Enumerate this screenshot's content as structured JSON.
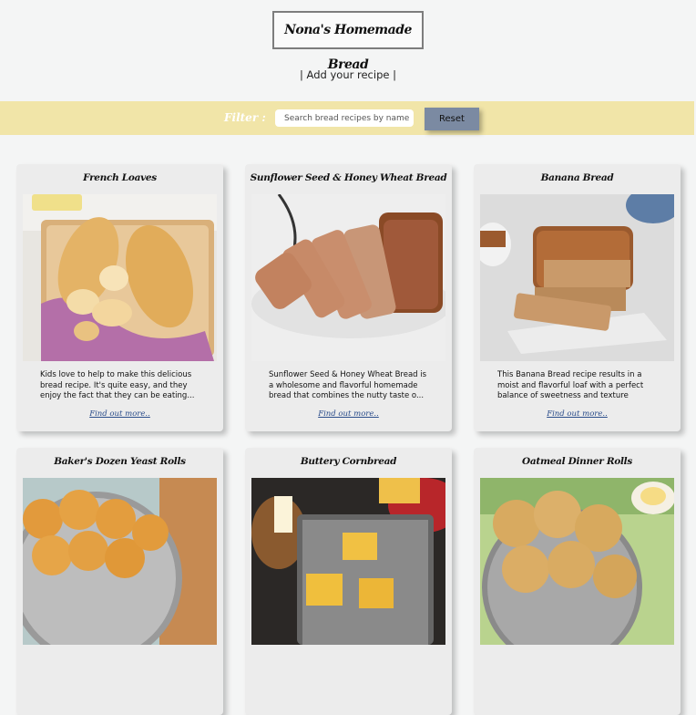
{
  "header": {
    "title": "Nona's Homemade Bread"
  },
  "nav": {
    "add_recipe": "| Add your recipe |"
  },
  "filter": {
    "label": "Filter :",
    "placeholder": "Search bread recipes by name",
    "reset_label": "Reset"
  },
  "cards": [
    {
      "title": "French Loaves",
      "description": "Kids love to help to make this delicious bread recipe. It's quite easy, and they enjoy the fact that they can be eating...",
      "link": "Find out more..",
      "image_icon": "french-loaves-image"
    },
    {
      "title": "Sunflower Seed & Honey Wheat Bread",
      "description": "Sunflower Seed & Honey Wheat Bread is a wholesome and flavorful homemade bread that combines the nutty taste o...",
      "link": "Find out more..",
      "image_icon": "wheat-bread-image"
    },
    {
      "title": "Banana Bread",
      "description": "This Banana Bread recipe results in a moist and flavorful loaf with a perfect balance of sweetness and texture",
      "link": "Find out more..",
      "image_icon": "banana-bread-image"
    },
    {
      "title": "Baker's Dozen Yeast Rolls",
      "description": "",
      "link": "",
      "image_icon": "yeast-rolls-image"
    },
    {
      "title": "Buttery Cornbread",
      "description": "",
      "link": "",
      "image_icon": "cornbread-image"
    },
    {
      "title": "Oatmeal Dinner Rolls",
      "description": "",
      "link": "",
      "image_icon": "dinner-rolls-image"
    }
  ]
}
